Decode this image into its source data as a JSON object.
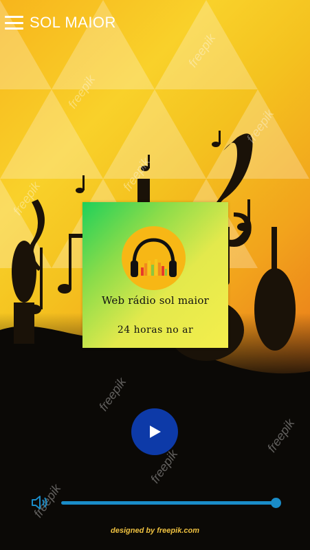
{
  "app": {
    "title": "SOL MAIOR",
    "menu_icon": "hamburger-menu-icon"
  },
  "station": {
    "name": "Web rádio sol maior",
    "tagline": "24  horas no ar",
    "logo_icon": "headphones-equalizer-icon"
  },
  "player": {
    "play_icon": "play-icon",
    "volume_icon": "speaker-volume-icon",
    "volume_level": 1.0
  },
  "background": {
    "credit": "designed by freepik.com",
    "watermark": "freepik"
  },
  "colors": {
    "play_button": "#0d3aa8",
    "slider": "#1a8cc8",
    "logo_bg": "#f7b715"
  }
}
